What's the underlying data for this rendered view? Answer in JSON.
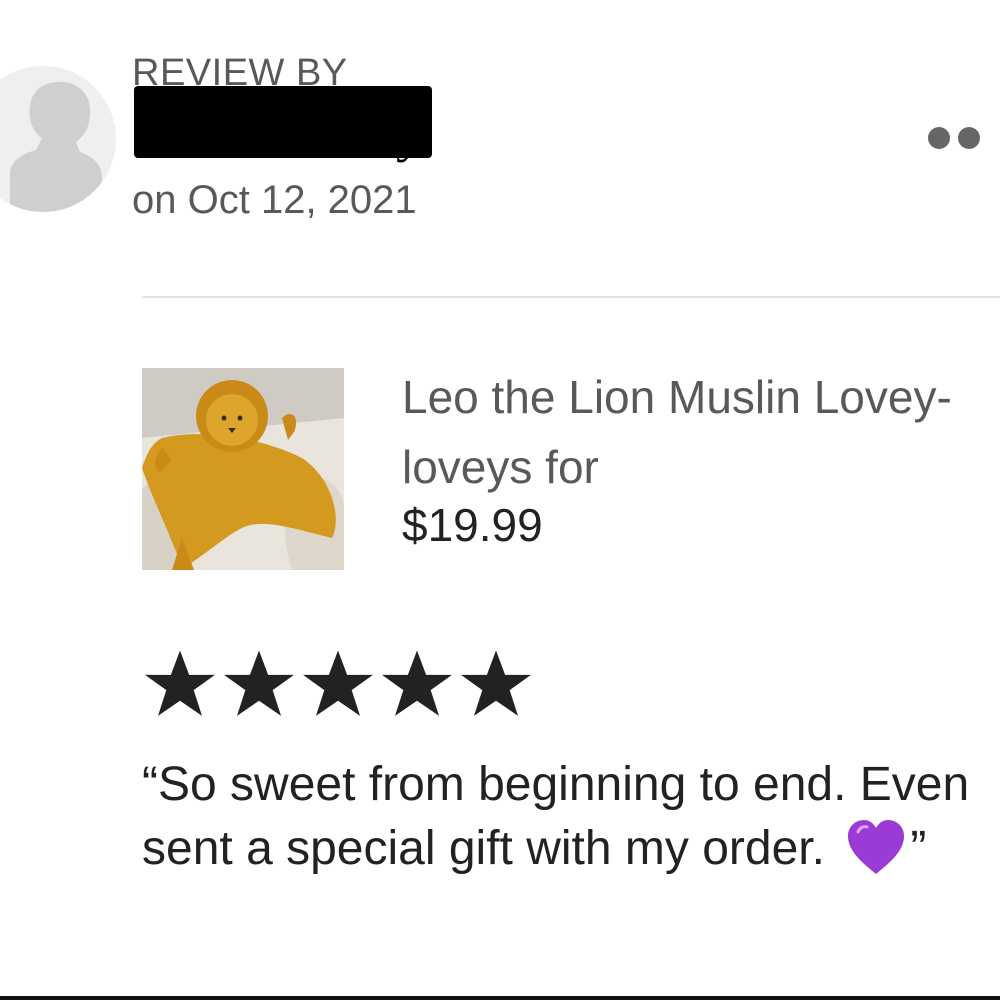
{
  "review": {
    "header_label": "REVIEW BY",
    "reviewer_name_visible_tail": "y",
    "date": "on Oct 12, 2021",
    "rating": 5,
    "rating_max": 5,
    "text_main": "“So sweet from beginning to end. Even sent a special gift with my order. ",
    "text_close": "”"
  },
  "product": {
    "title": "Leo the Lion Muslin Lovey-loveys for",
    "price": "$19.99"
  },
  "icons": {
    "more": "more-options-icon",
    "avatar": "default-user-avatar-icon",
    "star": "star-icon",
    "heart": "purple-heart-emoji-icon"
  },
  "colors": {
    "muted_text": "#595959",
    "star": "#222222",
    "heart": "#9b3bd6",
    "divider": "#e3e3e3"
  }
}
